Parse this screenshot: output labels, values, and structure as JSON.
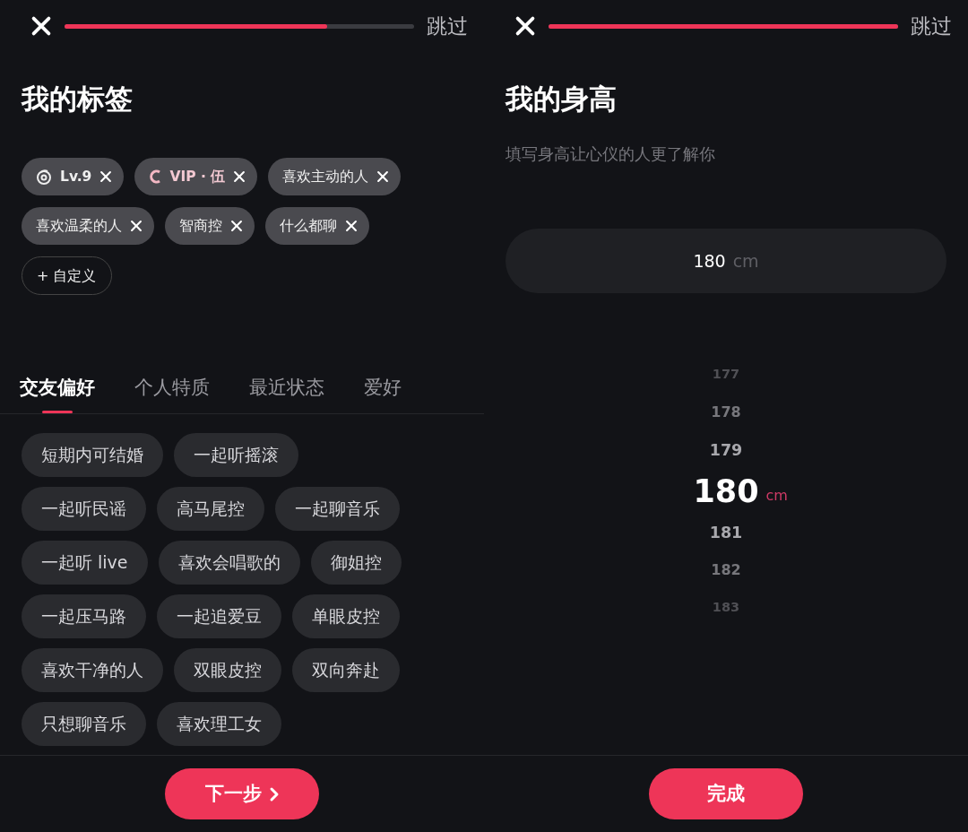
{
  "screens": [
    {
      "header": {
        "progress": {
          "level": 0.75
        },
        "skip": "跳过"
      },
      "title": "我的标签",
      "my_tags": [
        {
          "kind": "level",
          "label": "Lv.9"
        },
        {
          "kind": "vip",
          "label": "VIP · 伍"
        },
        {
          "kind": "text",
          "label": "喜欢主动的人"
        },
        {
          "kind": "text",
          "label": "喜欢温柔的人"
        },
        {
          "kind": "text",
          "label": "智商控"
        },
        {
          "kind": "text",
          "label": "什么都聊"
        }
      ],
      "custom_button": "+ 自定义",
      "tabs": [
        {
          "label": "交友偏好",
          "selected": true
        },
        {
          "label": "个人特质",
          "selected": false
        },
        {
          "label": "最近状态",
          "selected": false
        },
        {
          "label": "爱好",
          "selected": false
        }
      ],
      "options": [
        "短期内可结婚",
        "一起听摇滚",
        "一起听民谣",
        "高马尾控",
        "一起聊音乐",
        "一起听 live",
        "喜欢会唱歌的",
        "御姐控",
        "一起压马路",
        "一起追爱豆",
        "单眼皮控",
        "喜欢干净的人",
        "双眼皮控",
        "双向奔赴",
        "只想聊音乐",
        "喜欢理工女"
      ],
      "primary_button": {
        "label": "下一步",
        "chevron": true
      }
    },
    {
      "header": {
        "progress": {
          "level": 1.0
        },
        "skip": "跳过"
      },
      "title": "我的身高",
      "subtitle": "填写身高让心仪的人更了解你",
      "height_field": {
        "value": "180",
        "unit": "cm"
      },
      "picker": [
        {
          "value": "177",
          "selected": false
        },
        {
          "value": "178",
          "selected": false
        },
        {
          "value": "179",
          "selected": false
        },
        {
          "value": "180",
          "selected": true,
          "unit": "cm"
        },
        {
          "value": "181",
          "selected": false
        },
        {
          "value": "182",
          "selected": false
        },
        {
          "value": "183",
          "selected": false
        }
      ],
      "primary_button": {
        "label": "完成",
        "chevron": false
      }
    }
  ]
}
